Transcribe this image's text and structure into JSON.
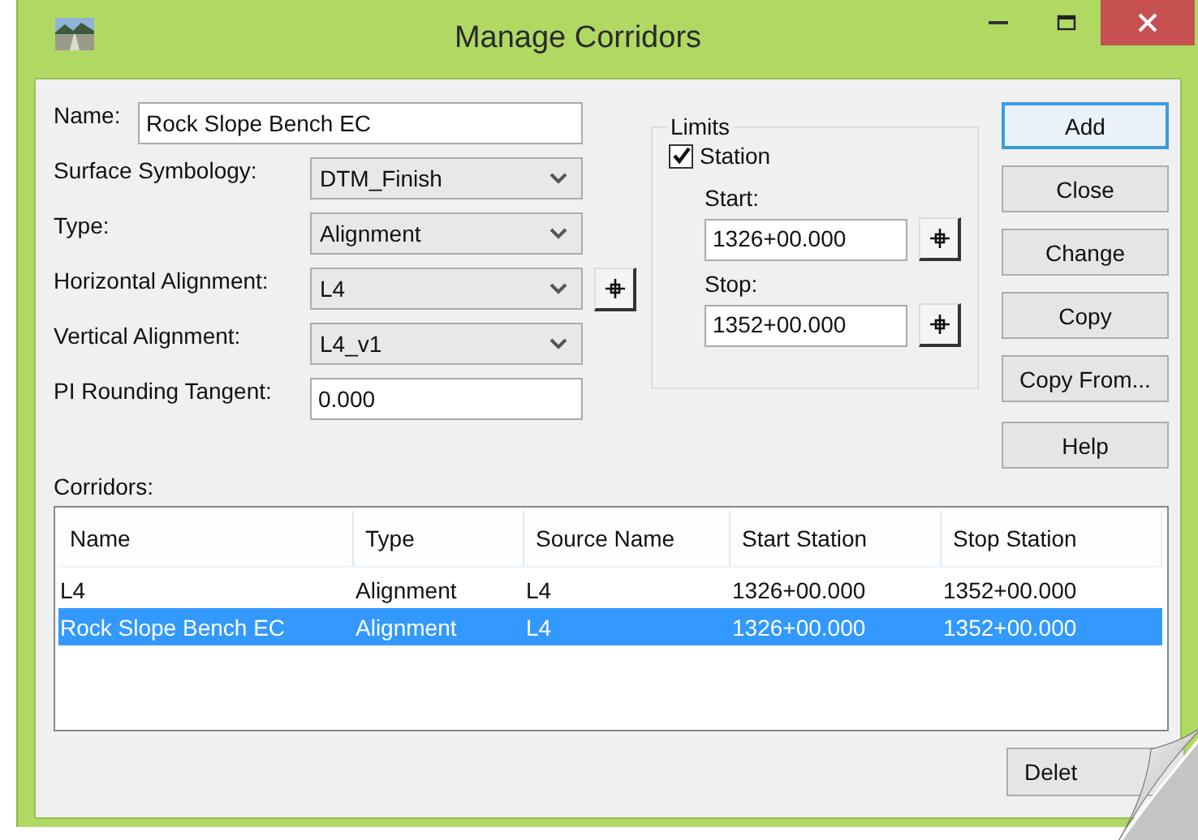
{
  "window": {
    "title": "Manage Corridors"
  },
  "form": {
    "fields": [
      {
        "kind": "text",
        "label": "Name:",
        "value": "Rock Slope Bench EC",
        "pick": false
      },
      {
        "kind": "dropdown",
        "label": "Surface Symbology:",
        "value": "DTM_Finish",
        "pick": false
      },
      {
        "kind": "dropdown",
        "label": "Type:",
        "value": "Alignment",
        "pick": false
      },
      {
        "kind": "dropdown",
        "label": "Horizontal Alignment:",
        "value": "L4",
        "pick": true
      },
      {
        "kind": "dropdown",
        "label": "Vertical Alignment:",
        "value": "L4_v1",
        "pick": false
      },
      {
        "kind": "text",
        "label": "PI Rounding Tangent:",
        "value": "0.000",
        "pick": false
      }
    ]
  },
  "limits": {
    "title": "Limits",
    "station": {
      "label": "Station",
      "checked": true
    },
    "fields": [
      {
        "label": "Start:",
        "value": "1326+00.000"
      },
      {
        "label": "Stop:",
        "value": "1352+00.000"
      }
    ]
  },
  "buttons": [
    {
      "label": "Add",
      "default": true
    },
    {
      "label": "Close",
      "default": false
    },
    {
      "label": "Change",
      "default": false
    },
    {
      "label": "Copy",
      "default": false
    },
    {
      "label": "Copy From...",
      "default": false
    },
    {
      "label": "Help",
      "default": false
    }
  ],
  "corridors": {
    "label": "Corridors:",
    "columns": [
      "Name",
      "Type",
      "Source Name",
      "Start Station",
      "Stop Station"
    ],
    "rows": [
      {
        "cells": [
          "L4",
          "Alignment",
          "L4",
          "1326+00.000",
          "1352+00.000"
        ],
        "selected": false
      },
      {
        "cells": [
          "Rock Slope Bench EC",
          "Alignment",
          "L4",
          "1326+00.000",
          "1352+00.000"
        ],
        "selected": true
      }
    ]
  },
  "delete_button": {
    "label": "Delet"
  }
}
